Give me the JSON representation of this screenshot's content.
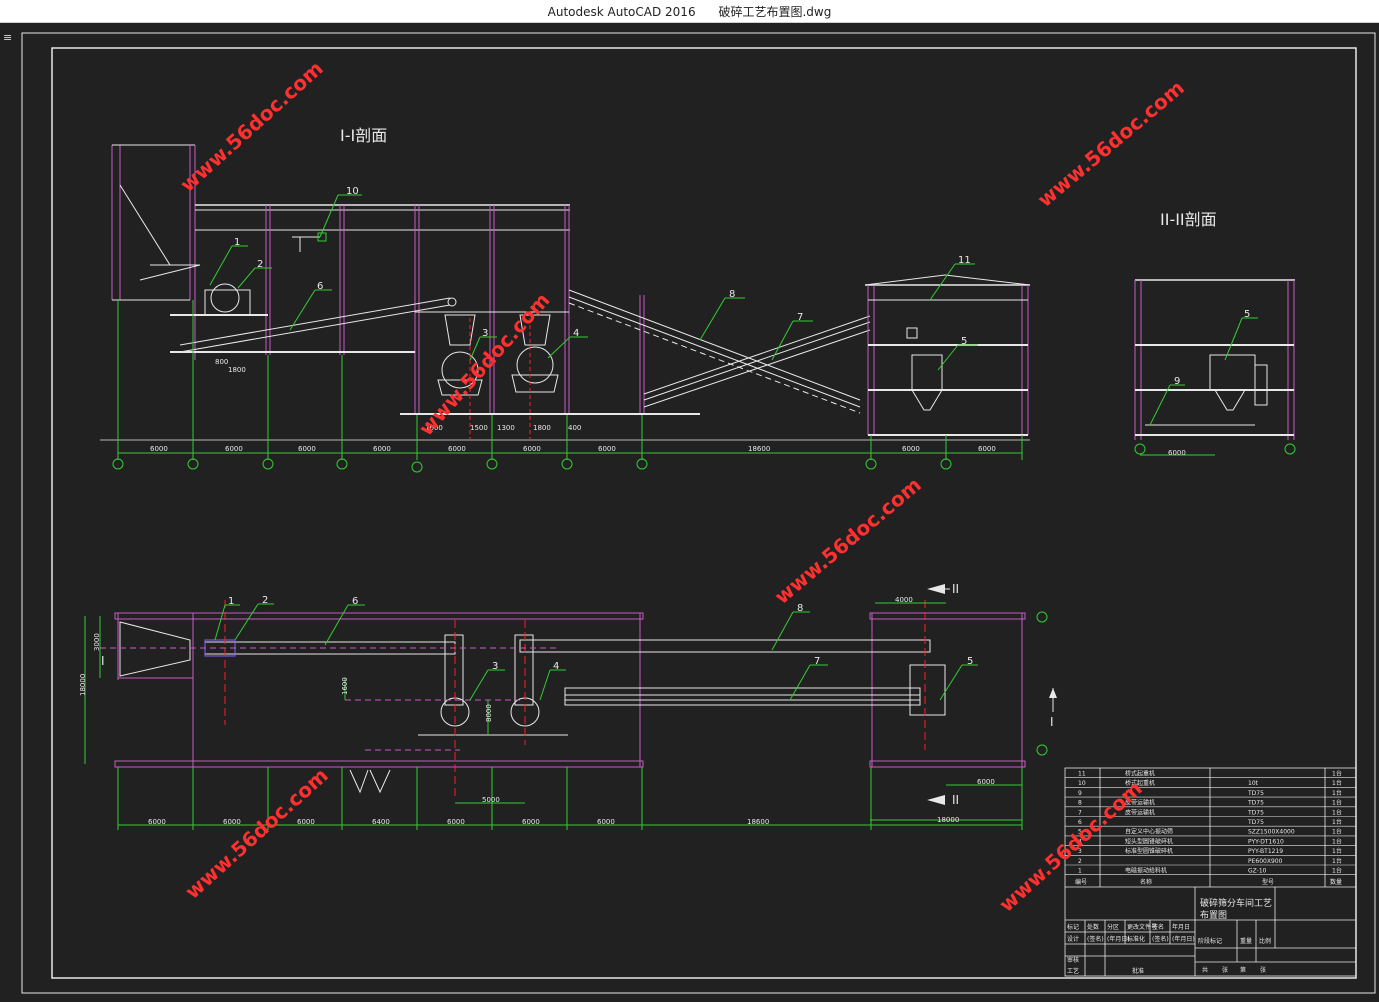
{
  "window": {
    "title_app": "Autodesk AutoCAD 2016",
    "title_file": "破碎工艺布置图.dwg",
    "menu_glyph": "≡"
  },
  "colors": {
    "background": "#212121",
    "white_lines": "#e8e8e8",
    "magenta": "#c85ac8",
    "green": "#33cc33",
    "red": "#ff2020",
    "watermark": "#ff3030"
  },
  "watermark": "www.56doc.com",
  "drawing": {
    "section1_title": "I-I剖面",
    "section2_title": "II-II剖面",
    "callouts_section1": [
      "1",
      "2",
      "3",
      "4",
      "5",
      "6",
      "7",
      "8",
      "10",
      "11"
    ],
    "callout_section2_5": "5",
    "callout_section2_9": "9",
    "plan_callouts": [
      "1",
      "2",
      "3",
      "4",
      "5",
      "6",
      "7",
      "8"
    ],
    "dims_section1": [
      "6000",
      "6000",
      "6000",
      "6000",
      "6000",
      "6000",
      "6000",
      "18600",
      "6000",
      "6000"
    ],
    "dims_section1_small": [
      "800",
      "1800",
      "1600",
      "1500",
      "1300",
      "1800",
      "400"
    ],
    "dim_section2": "6000",
    "dims_plan": [
      "6000",
      "6000",
      "6000",
      "6400",
      "6000",
      "6000",
      "6000",
      "18600",
      "18000"
    ],
    "dims_plan_misc": [
      "4000",
      "6000",
      "5000",
      "3000",
      "18000",
      "1600",
      "8000",
      "1600"
    ],
    "section_marks": {
      "plan_left": "I",
      "plan_right": "I",
      "plan_top": "II",
      "plan_bottom": "II"
    }
  },
  "title_block": {
    "parts": [
      {
        "no": "11",
        "name": "桥式起重机",
        "model": "",
        "qty": "1台"
      },
      {
        "no": "10",
        "name": "桥式起重机",
        "model": "10t",
        "qty": "1台"
      },
      {
        "no": "9",
        "name": "",
        "model": "TD75",
        "qty": "1台"
      },
      {
        "no": "8",
        "name": "皮带运输机",
        "model": "TD75",
        "qty": "1台"
      },
      {
        "no": "7",
        "name": "皮带运输机",
        "model": "TD75",
        "qty": "1台"
      },
      {
        "no": "6",
        "name": "",
        "model": "TD75",
        "qty": "1台"
      },
      {
        "no": "5",
        "name": "自定义中心振动筛",
        "model": "SZZ1500X4000",
        "qty": "1台"
      },
      {
        "no": "4",
        "name": "短头型圆锥破碎机",
        "model": "PYY-DT1610",
        "qty": "1台"
      },
      {
        "no": "3",
        "name": "标准型圆锥破碎机",
        "model": "PYY-BT1219",
        "qty": "1台"
      },
      {
        "no": "2",
        "name": "",
        "model": "PE600X900",
        "qty": "1台"
      },
      {
        "no": "1",
        "name": "电磁振动给料机",
        "model": "GZ-10",
        "qty": "1台"
      }
    ],
    "header": {
      "no": "编号",
      "name": "名称",
      "model": "型号",
      "qty": "数量"
    },
    "drawing_name_line1": "破碎筛分车间工艺",
    "drawing_name_line2": "布置图",
    "row_labels": [
      "标记",
      "处数",
      "分区",
      "更改文件号",
      "签名",
      "年月日"
    ],
    "row2_labels": [
      "设计",
      "(签名)",
      "(年月日)",
      "标准化",
      "(签名)",
      "(年月日)"
    ],
    "row3_labels": [
      "审核"
    ],
    "row4_labels": [
      "工艺",
      "批准"
    ],
    "stage_labels": [
      "阶段标记",
      "重量",
      "比例"
    ],
    "sheet_labels": [
      "共",
      "张",
      "第",
      "张"
    ]
  }
}
